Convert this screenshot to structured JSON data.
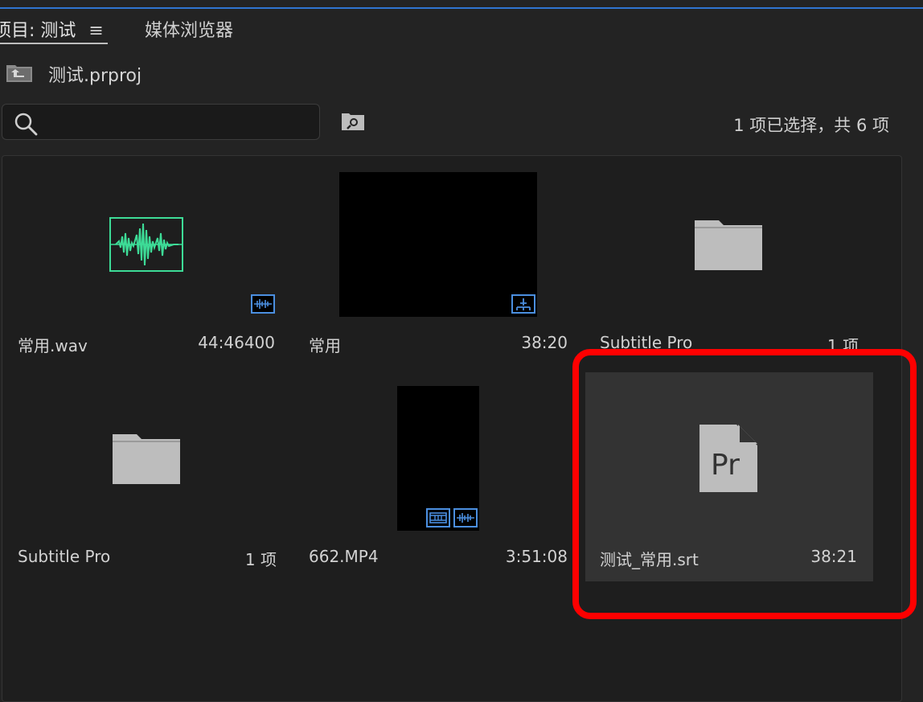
{
  "header": {
    "project_tab": "项目: 测试",
    "project_tab_menu": "≡",
    "media_browser_tab": "媒体浏览器"
  },
  "project": {
    "name": "测试.prproj"
  },
  "search": {
    "value": "",
    "placeholder": ""
  },
  "selection_count": "1 项已选择，共 6 项",
  "items": [
    {
      "name": "常用.wav",
      "meta": "44:46400",
      "icon": "audio-waveform-icon"
    },
    {
      "name": "常用",
      "meta": "38:20",
      "icon": "sequence-icon"
    },
    {
      "name": "Subtitle Pro",
      "meta": "1 项",
      "icon": "folder-icon"
    },
    {
      "name": "Subtitle Pro",
      "meta": "1 项",
      "icon": "folder-icon"
    },
    {
      "name": "662.MP4",
      "meta": "3:51:08",
      "icon": "video-audio-icon"
    },
    {
      "name": "测试_常用.srt",
      "meta": "38:21",
      "icon": "premiere-file-icon"
    }
  ],
  "colors": {
    "accent": "#2f74d0",
    "highlight": "#ff0000",
    "audio": "#3ddc97",
    "badge": "#4b8fe0"
  }
}
